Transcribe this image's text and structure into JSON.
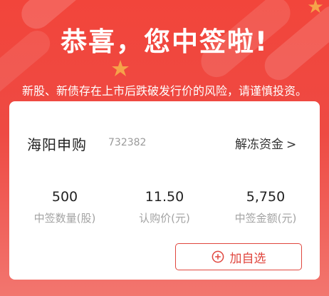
{
  "header": {
    "title": "恭喜，您中签啦!",
    "notice": "新股、新债存在上市后跌破发行价的风险，请谨慎投资。",
    "accent_color": "#f2453b"
  },
  "card": {
    "stock_name": "海阳申购",
    "stock_code": "732382",
    "unfreeze_label": "解冻资金",
    "unfreeze_arrow": ">",
    "stats": [
      {
        "value": "500",
        "label": "中签数量(股)"
      },
      {
        "value": "11.50",
        "label": "认购价(元)"
      },
      {
        "value": "5,750",
        "label": "中签金额(元)"
      }
    ],
    "add_button_label": "加自选",
    "add_button_icon": "plus-circle-icon",
    "button_color": "#e0463e"
  }
}
